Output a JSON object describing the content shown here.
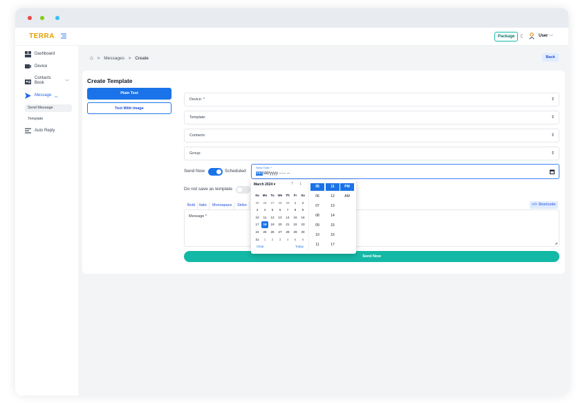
{
  "app": {
    "logo": "TERRA"
  },
  "header": {
    "package_label": "Package",
    "user_label": "User"
  },
  "sidebar": {
    "items": [
      {
        "label": "Dashboard",
        "icon": "dashboard-icon"
      },
      {
        "label": "Device",
        "icon": "device-icon"
      },
      {
        "label": "Contacts Book",
        "icon": "contacts-book-icon"
      },
      {
        "label": "Message",
        "icon": "send-icon"
      },
      {
        "label": "Auto Reply",
        "icon": "auto-reply-icon"
      }
    ],
    "submenu": [
      {
        "label": "Send Message",
        "active": true
      },
      {
        "label": "Template",
        "active": false
      }
    ]
  },
  "breadcrumb": {
    "parent": "Messages",
    "current": "Create"
  },
  "back_label": "Back",
  "form": {
    "title": "Create Template",
    "type_buttons": {
      "plain": "Plain Text",
      "image": "Text With Image"
    },
    "fields": {
      "device": "Device: *",
      "template": "Template:",
      "contacts": "Contacts:",
      "group": "Group:"
    },
    "send_now_label": "Send Now",
    "scheduled_label": "Scheduled",
    "send_time": {
      "label": "Send Time: *",
      "value_highlight": "mm",
      "value_rest": "/dd/yyyy --:-- --"
    },
    "do_not_save_label": "Do not save as template",
    "format_buttons": [
      "Bold",
      "Italic",
      "Monospace",
      "Strike"
    ],
    "shortcode_label": "</> Shortcode",
    "message_label": "Message *",
    "send_button": "Send Now"
  },
  "datepicker": {
    "month_label": "March 2024 ▾",
    "weekdays": [
      "Su",
      "Mo",
      "Tu",
      "We",
      "Th",
      "Fr",
      "Sa"
    ],
    "days": [
      [
        "25",
        "26",
        "27",
        "28",
        "29",
        "1",
        "2"
      ],
      [
        "3",
        "4",
        "5",
        "6",
        "7",
        "8",
        "9"
      ],
      [
        "10",
        "11",
        "12",
        "13",
        "14",
        "15",
        "16"
      ],
      [
        "17",
        "18",
        "19",
        "20",
        "21",
        "22",
        "23"
      ],
      [
        "24",
        "25",
        "26",
        "27",
        "28",
        "29",
        "30"
      ],
      [
        "31",
        "1",
        "2",
        "3",
        "4",
        "5",
        "6"
      ]
    ],
    "selected_day": "18",
    "clear_label": "Clear",
    "today_label": "Today",
    "hours": [
      "05",
      "06",
      "07",
      "08",
      "09",
      "10",
      "11"
    ],
    "minutes": [
      "11",
      "12",
      "13",
      "14",
      "15",
      "16",
      "17"
    ],
    "ampm": [
      "PM",
      "AM"
    ]
  },
  "colors": {
    "primary": "#1a73e8",
    "accent": "#14b8a6",
    "logo": "#e2a100"
  }
}
